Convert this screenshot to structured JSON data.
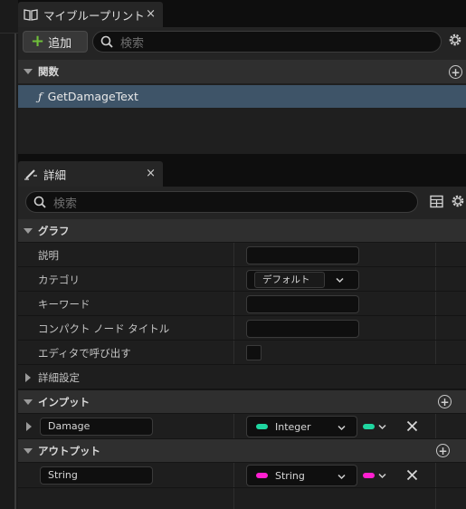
{
  "blueprint_panel": {
    "tab_title": "マイブループリント",
    "tab_close": "×",
    "add_label": "追加",
    "search_placeholder": "検索",
    "functions_header": "関数",
    "function_item": "GetDamageText"
  },
  "details_panel": {
    "tab_title": "詳細",
    "tab_close": "×",
    "search_placeholder": "検索",
    "graph_header": "グラフ",
    "rows": {
      "description": "説明",
      "category": "カテゴリ",
      "category_value": "デフォルト",
      "keywords": "キーワード",
      "compact_node_title": "コンパクト ノード タイトル",
      "call_in_editor": "エディタで呼び出す",
      "advanced": "詳細設定"
    },
    "inputs_header": "インプット",
    "outputs_header": "アウトプット",
    "inputs": [
      {
        "name": "Damage",
        "type": "Integer",
        "color": "#1fd6a0"
      }
    ],
    "outputs": [
      {
        "name": "String",
        "type": "String",
        "color": "#ff1fd0"
      }
    ]
  },
  "colors": {
    "selection": "#3e5468",
    "add_plus": "#6fbf3a",
    "integer_pin": "#1fd6a0",
    "string_pin": "#ff1fd0"
  }
}
